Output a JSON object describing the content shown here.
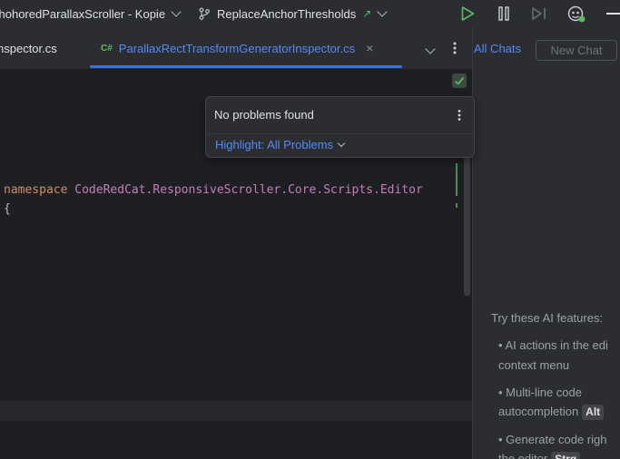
{
  "titlebar": {
    "project_name": "chohoredParallaxScroller - Kopie",
    "branch_name": "ReplaceAnchorThresholds",
    "branch_arrow": "↗"
  },
  "tabs": [
    {
      "label": "nspector.cs",
      "active": false
    },
    {
      "label": "ParallaxRectTransformGeneratorInspector.cs",
      "active": true,
      "lang_badge": "C#"
    }
  ],
  "editor": {
    "code_line_1": {
      "keyword": "namespace",
      "name": "CodeRedCat.ResponsiveScroller.Core.Scripts.Editor"
    },
    "code_line_2": "{"
  },
  "problems_popup": {
    "message": "No problems found",
    "highlight_label": "Highlight: All Problems"
  },
  "ai_panel": {
    "tab_all_chats": "All Chats",
    "new_chat_button": "New Chat",
    "intro": "Try these AI features:",
    "features": [
      {
        "line1": "• AI actions in the edi",
        "line2": "context menu"
      },
      {
        "line1": "• Multi-line code",
        "line2": "autocompletion",
        "key": "Alt"
      },
      {
        "line1": "• Generate code righ",
        "line2": "the editor",
        "key": "Strg"
      }
    ]
  },
  "colors": {
    "accent": "#3574f0",
    "run_green": "#5fb865",
    "ok_green": "#5fb865"
  }
}
